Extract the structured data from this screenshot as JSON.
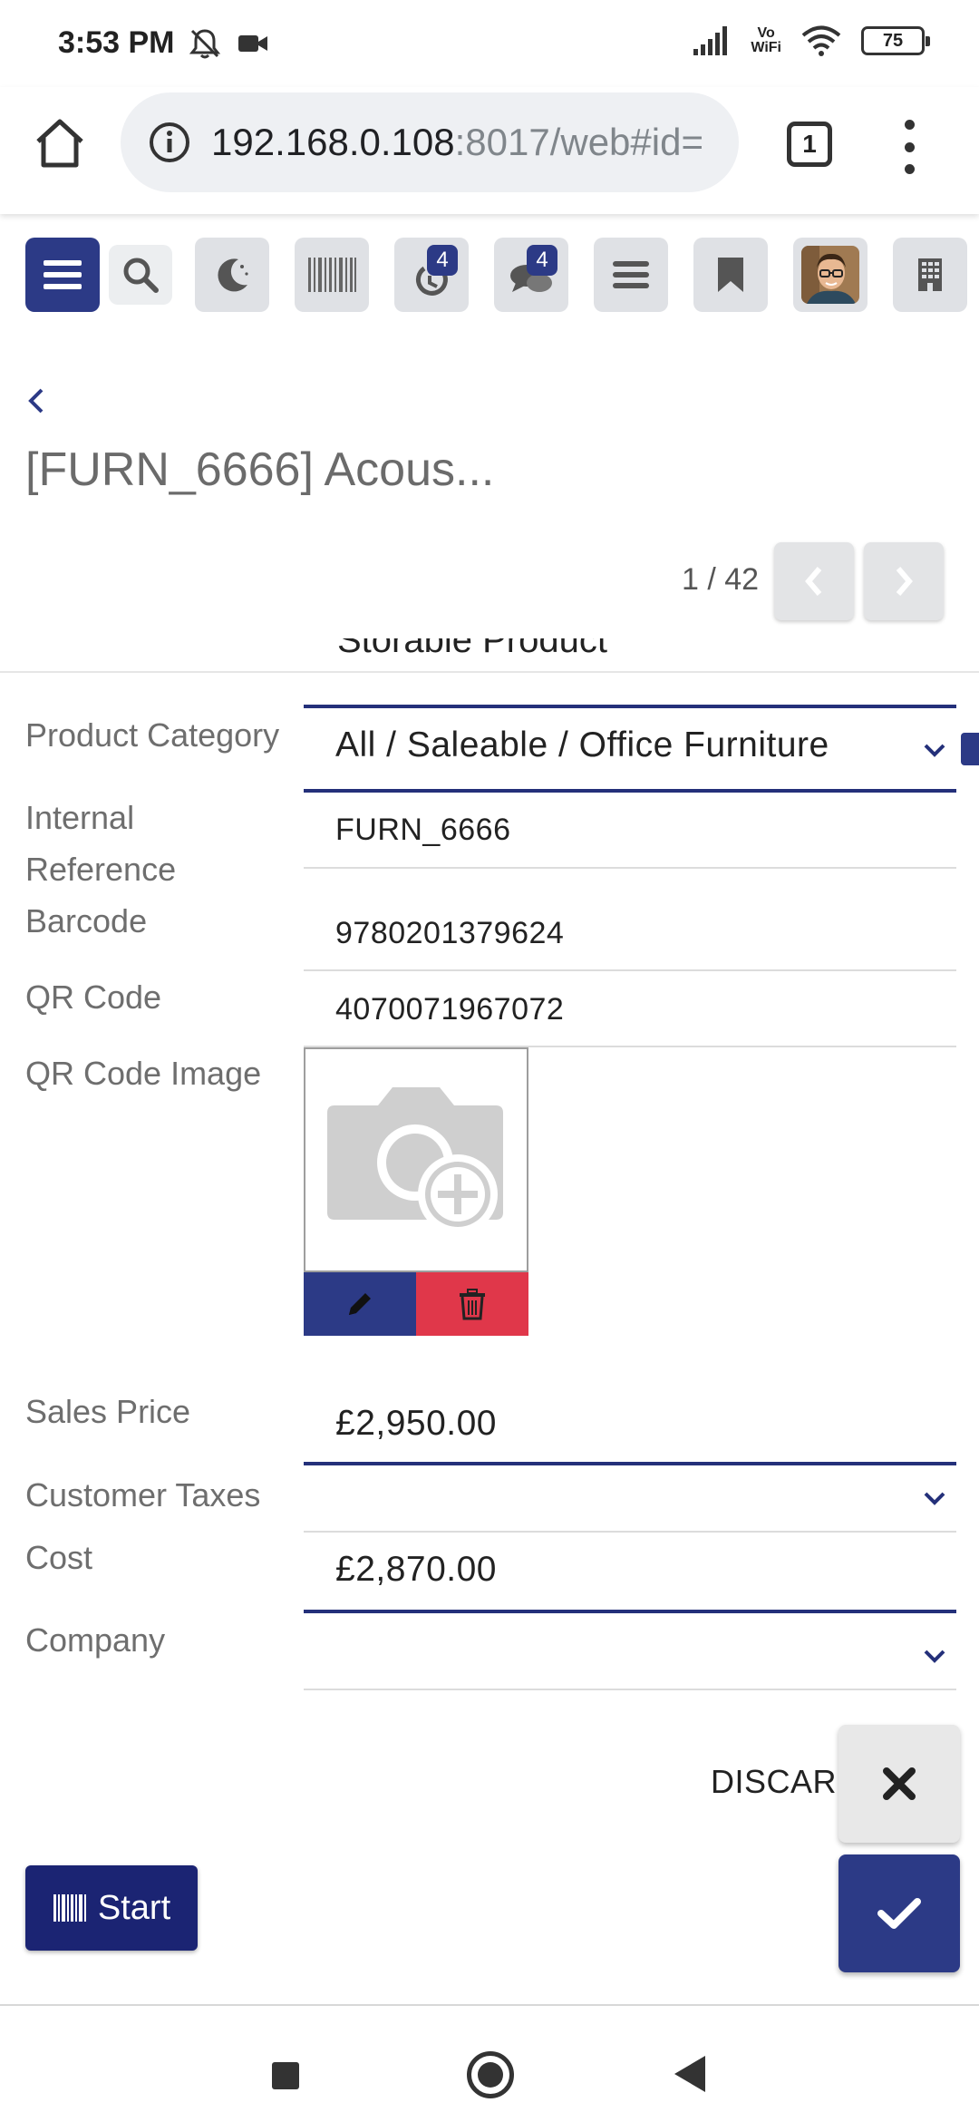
{
  "status_bar": {
    "time": "3:53 PM",
    "vowifi_line1": "Vo",
    "vowifi_line2": "WiFi",
    "battery": "75",
    "icons": [
      "dnd-off-icon",
      "video-camera-icon",
      "signal-icon",
      "wifi-icon",
      "battery-icon"
    ]
  },
  "browser": {
    "url_host": "192.168.0.108",
    "url_rest": ":8017/web#id=",
    "tab_count": "1",
    "icons": [
      "home-icon",
      "info-icon",
      "tabs-icon",
      "more-vert-icon"
    ]
  },
  "toolbar": {
    "badges": {
      "activity": "4",
      "messages": "4"
    },
    "icons": [
      "menu-icon",
      "search-icon",
      "moon-icon",
      "barcode-icon",
      "activity-icon",
      "chat-icon",
      "list-icon",
      "bookmark-icon",
      "avatar",
      "building-icon"
    ]
  },
  "header": {
    "title": "[FURN_6666] Acous...",
    "pager": "1 / 42",
    "icons": [
      "back-icon",
      "chevron-left-icon",
      "chevron-right-icon"
    ]
  },
  "form": {
    "partial_above": "Storable Product",
    "product_category": {
      "label": "Product Category",
      "value": "All / Saleable / Office Furniture"
    },
    "internal_reference": {
      "label_line1": "Internal",
      "label_line2": "Reference",
      "value": "FURN_6666"
    },
    "barcode": {
      "label": "Barcode",
      "value": "9780201379624"
    },
    "qr_code": {
      "label": "QR Code",
      "value": "4070071967072"
    },
    "qr_code_image": {
      "label": "QR Code Image"
    },
    "sales_price": {
      "label": "Sales Price",
      "value": "£2,950.00"
    },
    "customer_taxes": {
      "label": "Customer Taxes",
      "value": ""
    },
    "cost": {
      "label": "Cost",
      "value": "£2,870.00"
    },
    "company": {
      "label": "Company",
      "value": ""
    }
  },
  "actions": {
    "discard_label": "DISCARD",
    "start_label": "Start"
  },
  "colors": {
    "primary": "#2c3a86",
    "primary_dark": "#1b2473",
    "danger": "#e0374a",
    "toolbar_button": "#dfe1e5"
  }
}
